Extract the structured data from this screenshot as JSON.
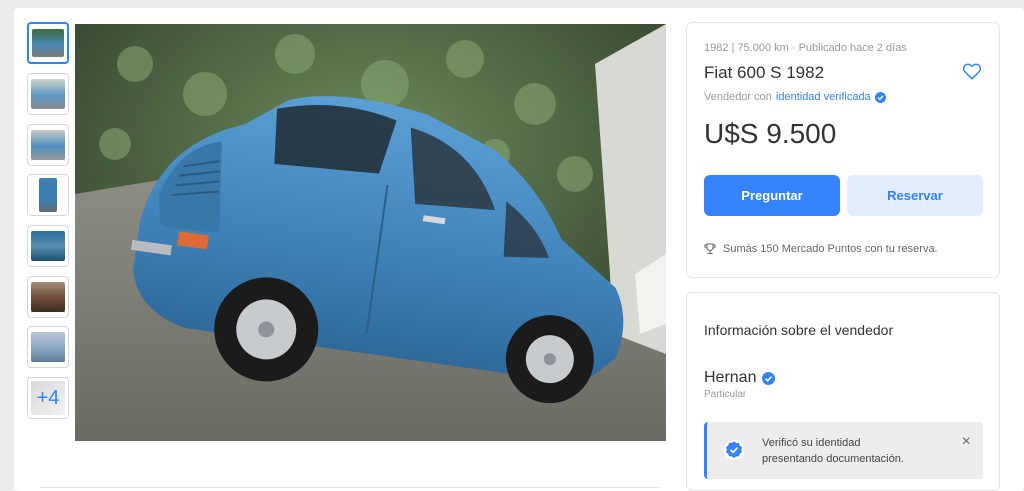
{
  "gallery": {
    "thumbnails": [
      {
        "name": "thumbnail-1",
        "color": "#4a86b5",
        "selected": true
      },
      {
        "name": "thumbnail-2",
        "color": "#5c96c4",
        "selected": false
      },
      {
        "name": "thumbnail-3",
        "color": "#4f8fc0",
        "selected": false
      },
      {
        "name": "thumbnail-4",
        "color": "#3f7fb0",
        "selected": false
      },
      {
        "name": "thumbnail-5",
        "color": "#2d6f9e",
        "selected": false
      },
      {
        "name": "thumbnail-6",
        "color": "#6b4a36",
        "selected": false
      },
      {
        "name": "thumbnail-7",
        "color": "#8aa7c2",
        "selected": false
      }
    ],
    "more_label": "+4"
  },
  "listing": {
    "subtitle": "1982 | 75.000 km · Publicado hace 2 días",
    "title": "Fiat 600 S 1982",
    "seller_prefix": "Vendedor con",
    "seller_verified_link": "identidad verificada",
    "price": "U$S 9.500",
    "ask_button": "Preguntar",
    "reserve_button": "Reservar",
    "points_text": "Sumás 150 Mercado Puntos con tu reserva."
  },
  "seller": {
    "heading": "Información sobre el vendedor",
    "name": "Hernan",
    "type": "Particular",
    "notice_line1": "Verificó su identidad",
    "notice_line2": "presentando documentación.",
    "close_icon": "×"
  },
  "colors": {
    "accent": "#3483fa",
    "accent_light": "#e3edfb",
    "car_blue": "#4a8ec4"
  }
}
